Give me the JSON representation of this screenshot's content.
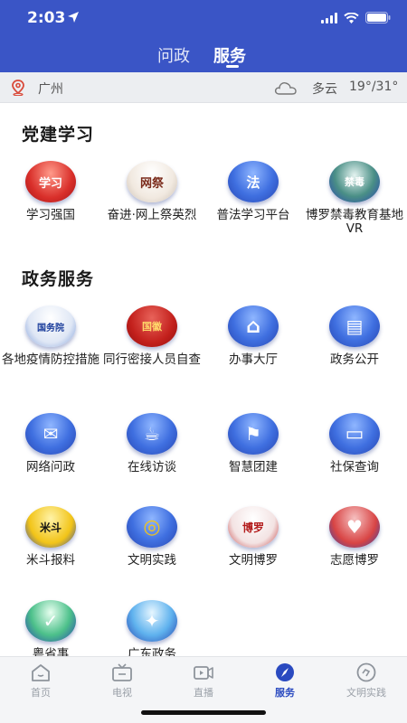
{
  "status_bar": {
    "time": "2:03"
  },
  "header": {
    "tabs": [
      {
        "label": "问政",
        "active": false
      },
      {
        "label": "服务",
        "active": true
      }
    ],
    "accent_color": "#3a55c6"
  },
  "weather_bar": {
    "city": "广州",
    "condition": "多云",
    "temperature": "19°/31°"
  },
  "sections": [
    {
      "title": "党建学习",
      "items": [
        {
          "label": "学习强国",
          "icon": "xuexi-qiangguo-icon",
          "glyph": "学习"
        },
        {
          "label": "奋进·网上祭英烈",
          "icon": "memorial-icon",
          "glyph": "网祭"
        },
        {
          "label": "普法学习平台",
          "icon": "law-icon",
          "glyph": "法"
        },
        {
          "label": "博罗禁毒教育基地VR",
          "icon": "anti-drug-emblem-icon",
          "glyph": "禁毒"
        }
      ]
    },
    {
      "title": "政务服务",
      "items": [
        {
          "label": "各地疫情防控措施",
          "icon": "state-council-icon",
          "glyph": "国务院"
        },
        {
          "label": "同行密接人员自查",
          "icon": "national-emblem-icon",
          "glyph": "国徽"
        },
        {
          "label": "办事大厅",
          "icon": "house-icon",
          "glyph": "⌂"
        },
        {
          "label": "政务公开",
          "icon": "message-screen-icon",
          "glyph": "▤"
        },
        {
          "label": "网络问政",
          "icon": "chat-bubble-icon",
          "glyph": "✉"
        },
        {
          "label": "在线访谈",
          "icon": "coffee-cup-icon",
          "glyph": "☕"
        },
        {
          "label": "智慧团建",
          "icon": "flag-icon",
          "glyph": "⚑"
        },
        {
          "label": "社保查询",
          "icon": "id-card-icon",
          "glyph": "▭"
        },
        {
          "label": "米斗报料",
          "icon": "midou-icon",
          "glyph": "米斗"
        },
        {
          "label": "文明实践",
          "icon": "civilization-practice-icon",
          "glyph": "◎"
        },
        {
          "label": "文明博罗",
          "icon": "civilization-boluo-icon",
          "glyph": "博罗"
        },
        {
          "label": "志愿博罗",
          "icon": "volunteer-icon",
          "glyph": "♥"
        },
        {
          "label": "粤省事",
          "icon": "yueshengshi-icon",
          "glyph": "✓"
        },
        {
          "label": "广东政务",
          "icon": "guangdong-gov-icon",
          "glyph": "✦"
        }
      ]
    }
  ],
  "bottom_nav": [
    {
      "label": "首页",
      "icon": "home-icon",
      "active": false
    },
    {
      "label": "电视",
      "icon": "tv-icon",
      "active": false
    },
    {
      "label": "直播",
      "icon": "live-camera-icon",
      "active": false
    },
    {
      "label": "服务",
      "icon": "compass-icon",
      "active": true
    },
    {
      "label": "文明实践",
      "icon": "practice-icon",
      "active": false
    }
  ]
}
